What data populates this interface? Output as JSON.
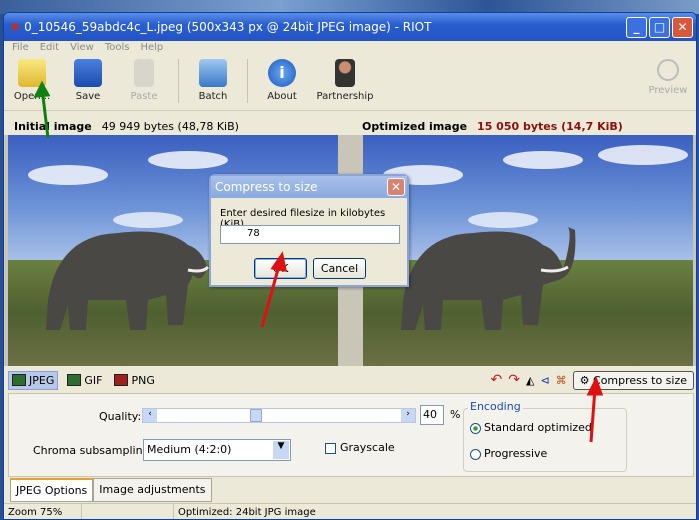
{
  "window": {
    "title": "0_10546_59abdc4c_L.jpeg (500x343 px @ 24bit JPEG image) - RIOT"
  },
  "menu": [
    "File",
    "Edit",
    "View",
    "Tools",
    "Help"
  ],
  "toolbar": {
    "open": "Open...",
    "save": "Save",
    "paste": "Paste",
    "batch": "Batch",
    "about": "About",
    "partnership": "Partnership",
    "preview": "Preview"
  },
  "info": {
    "initial_label": "Initial image",
    "initial_size": "49 949 bytes (48,78 KiB)",
    "optimized_label": "Optimized image",
    "optimized_size": "15 050 bytes (14,7 KiB)"
  },
  "formats": [
    "JPEG",
    "GIF",
    "PNG"
  ],
  "compress_to_size": "Compress to size",
  "options": {
    "quality_label": "Quality:",
    "quality_value": "40",
    "quality_unit": "%",
    "quality_percent": 40,
    "chroma_label": "Chroma subsampling:",
    "chroma_value": "Medium (4:2:0)",
    "grayscale": "Grayscale",
    "encoding_label": "Encoding",
    "standard": "Standard optimized",
    "progressive": "Progressive"
  },
  "tabs": [
    "JPEG Options",
    "Image adjustments"
  ],
  "status": {
    "zoom": "Zoom 75%",
    "info": "Optimized: 24bit JPG image"
  },
  "dialog": {
    "title": "Compress to size",
    "prompt": "Enter desired filesize in kilobytes (KiB)",
    "value": "78",
    "ok": "OK",
    "cancel": "Cancel"
  },
  "colors": {
    "titlebar": "#2a5fd0",
    "optimized_size": "#8a1010",
    "arrow_red": "#e01010",
    "arrow_green": "#108010"
  }
}
